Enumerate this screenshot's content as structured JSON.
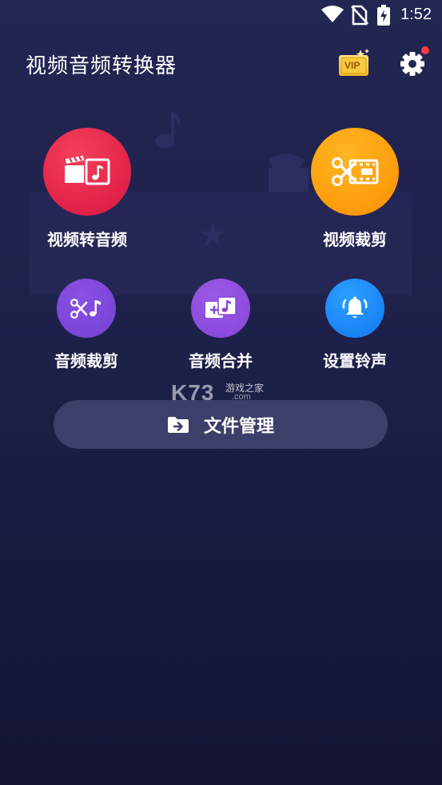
{
  "status_bar": {
    "time": "1:52",
    "icons": [
      "wifi-icon",
      "no-sim-icon",
      "battery-charging-icon"
    ]
  },
  "app_bar": {
    "title": "视频音频转换器",
    "vip_label": "VIP",
    "vip_icon": "vip-badge-icon",
    "settings_icon": "gear-icon",
    "has_notification": true
  },
  "features": {
    "video_to_audio": {
      "label": "视频转音频",
      "icon": "film-music-icon",
      "color": "#e5264a"
    },
    "video_cut": {
      "label": "视频裁剪",
      "icon": "scissors-film-icon",
      "color": "#ff9f0e"
    },
    "audio_cut": {
      "label": "音频裁剪",
      "icon": "scissors-note-icon",
      "color": "#7441d2"
    },
    "audio_merge": {
      "label": "音频合并",
      "icon": "merge-audio-icon",
      "color": "#8646d8"
    },
    "ringtone": {
      "label": "设置铃声",
      "icon": "bell-icon",
      "color": "#1478f2"
    }
  },
  "watermark": {
    "brand": "K73",
    "tagline": "游戏之家",
    "domain": ".com"
  },
  "file_manager": {
    "label": "文件管理",
    "icon": "folder-arrow-icon"
  }
}
